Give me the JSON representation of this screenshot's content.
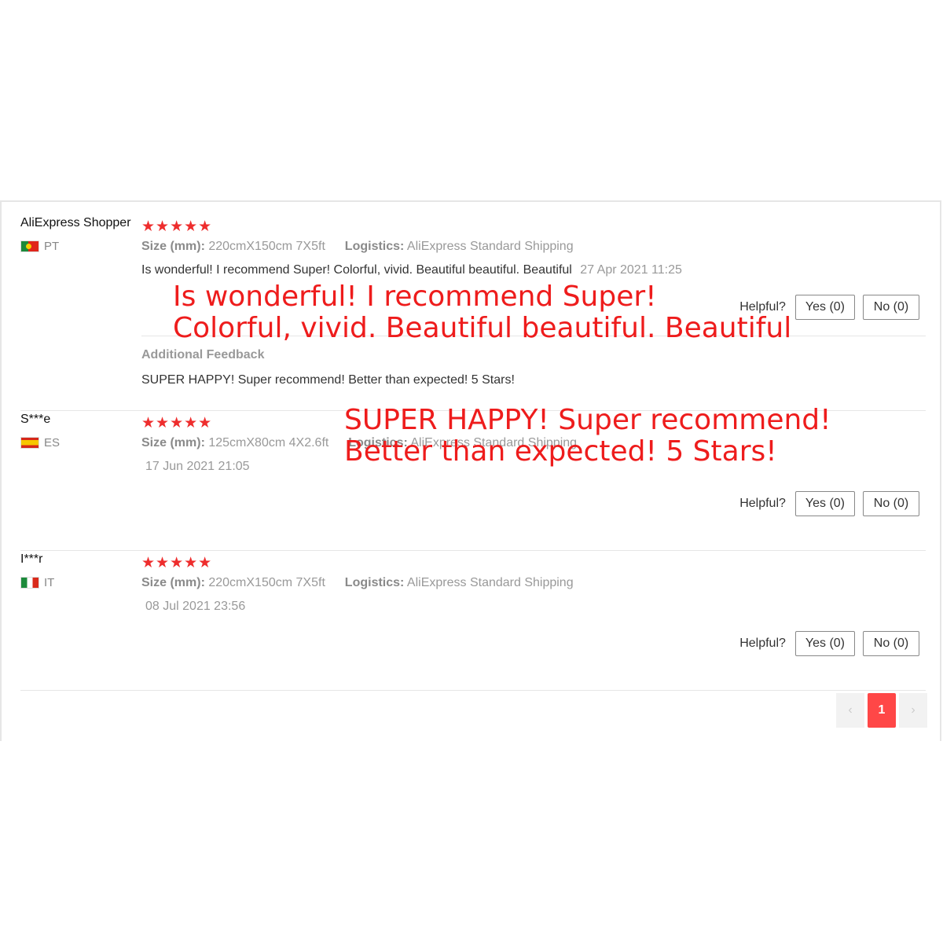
{
  "reviews": [
    {
      "user": "AliExpress Shopper",
      "country": "PT",
      "stars": "★★★★★",
      "size_label": "Size (mm):",
      "size_value": "220cmX150cm 7X5ft",
      "logistics_label": "Logistics:",
      "logistics_value": "AliExpress Standard Shipping",
      "text": "Is wonderful! I recommend Super! Colorful, vivid. Beautiful beautiful. Beautiful",
      "date": "27 Apr 2021 11:25",
      "helpful_label": "Helpful?",
      "yes_label": "Yes (0)",
      "no_label": "No (0)",
      "additional_title": "Additional Feedback",
      "additional_text": "SUPER HAPPY! Super recommend! Better than expected! 5 Stars!"
    },
    {
      "user": "S***e",
      "country": "ES",
      "stars": "★★★★★",
      "size_label": "Size (mm):",
      "size_value": "125cmX80cm 4X2.6ft",
      "logistics_label": "Logistics:",
      "logistics_value": "AliExpress Standard Shipping",
      "date": "17 Jun 2021 21:05",
      "helpful_label": "Helpful?",
      "yes_label": "Yes (0)",
      "no_label": "No (0)"
    },
    {
      "user": "I***r",
      "country": "IT",
      "stars": "★★★★★",
      "size_label": "Size (mm):",
      "size_value": "220cmX150cm 7X5ft",
      "logistics_label": "Logistics:",
      "logistics_value": "AliExpress Standard Shipping",
      "date": "08 Jul 2021 23:56",
      "helpful_label": "Helpful?",
      "yes_label": "Yes (0)",
      "no_label": "No (0)"
    }
  ],
  "overlays": {
    "first_line1": "Is wonderful! I recommend Super!",
    "first_line2": "Colorful, vivid. Beautiful beautiful. Beautiful",
    "second_line1": "SUPER HAPPY! Super recommend!",
    "second_line2": "Better than expected! 5 Stars!"
  },
  "pagination": {
    "prev": "‹",
    "current": "1",
    "next": "›"
  },
  "colors": {
    "accent": "#ff4747",
    "stars": "#ee2d2d",
    "overlay_text": "#ee1c1c"
  }
}
